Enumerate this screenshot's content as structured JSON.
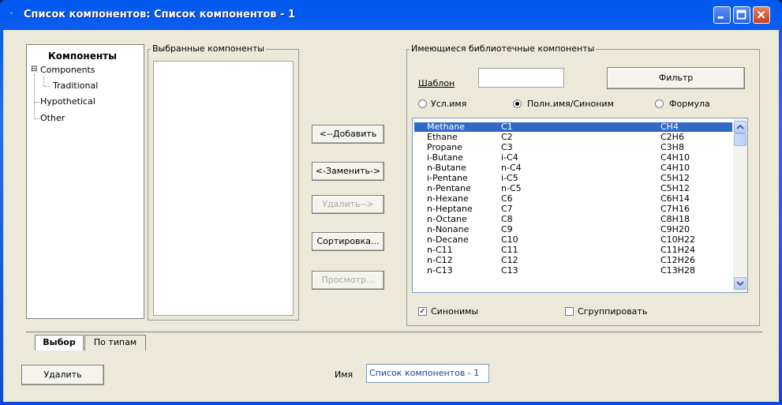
{
  "window": {
    "title": "Список компонентов: Список компонентов - 1",
    "icon": "app-icon",
    "minimize_icon": "minimize-icon",
    "maximize_icon": "maximize-icon",
    "close_icon": "close-icon"
  },
  "tree": {
    "header": "Компоненты",
    "items": [
      {
        "label": "Components",
        "expander": "⊟"
      },
      {
        "label": "Traditional"
      },
      {
        "label": "Hypothetical"
      },
      {
        "label": "Other"
      }
    ]
  },
  "selected_group": {
    "title": "Выбранные компоненты"
  },
  "actions": {
    "add": "<--Добавить",
    "replace": "<-Заменить->",
    "remove": "Удалить-->",
    "sort": "Сортировка...",
    "view": "Просмотр..."
  },
  "library": {
    "title": "Имеющиеся библиотечные компоненты",
    "pattern_label": "Шаблон",
    "pattern_value": "",
    "filter_button": "Фильтр",
    "radio_short": "Усл.имя",
    "radio_full": "Полн.имя/Синоним",
    "radio_formula": "Формула",
    "selected_radio": "full",
    "rows": [
      {
        "name": "Methane",
        "short": "C1",
        "formula": "CH4"
      },
      {
        "name": "Ethane",
        "short": "C2",
        "formula": "C2H6"
      },
      {
        "name": "Propane",
        "short": "C3",
        "formula": "C3H8"
      },
      {
        "name": "i-Butane",
        "short": "i-C4",
        "formula": "C4H10"
      },
      {
        "name": "n-Butane",
        "short": "n-C4",
        "formula": "C4H10"
      },
      {
        "name": "i-Pentane",
        "short": "i-C5",
        "formula": "C5H12"
      },
      {
        "name": "n-Pentane",
        "short": "n-C5",
        "formula": "C5H12"
      },
      {
        "name": "n-Hexane",
        "short": "C6",
        "formula": "C6H14"
      },
      {
        "name": "n-Heptane",
        "short": "C7",
        "formula": "C7H16"
      },
      {
        "name": "n-Octane",
        "short": "C8",
        "formula": "C8H18"
      },
      {
        "name": "n-Nonane",
        "short": "C9",
        "formula": "C9H20"
      },
      {
        "name": "n-Decane",
        "short": "C10",
        "formula": "C10H22"
      },
      {
        "name": "n-C11",
        "short": "C11",
        "formula": "C11H24"
      },
      {
        "name": "n-C12",
        "short": "C12",
        "formula": "C12H26"
      },
      {
        "name": "n-C13",
        "short": "C13",
        "formula": "C13H28"
      }
    ],
    "synonyms_label": "Синонимы",
    "synonyms_checked": true,
    "group_label": "Сгруппировать",
    "group_checked": false
  },
  "tabs": {
    "select": "Выбор",
    "by_type": "По типам"
  },
  "footer": {
    "delete_button": "Удалить",
    "name_label": "Имя",
    "name_value": "Список компонентов - 1"
  }
}
